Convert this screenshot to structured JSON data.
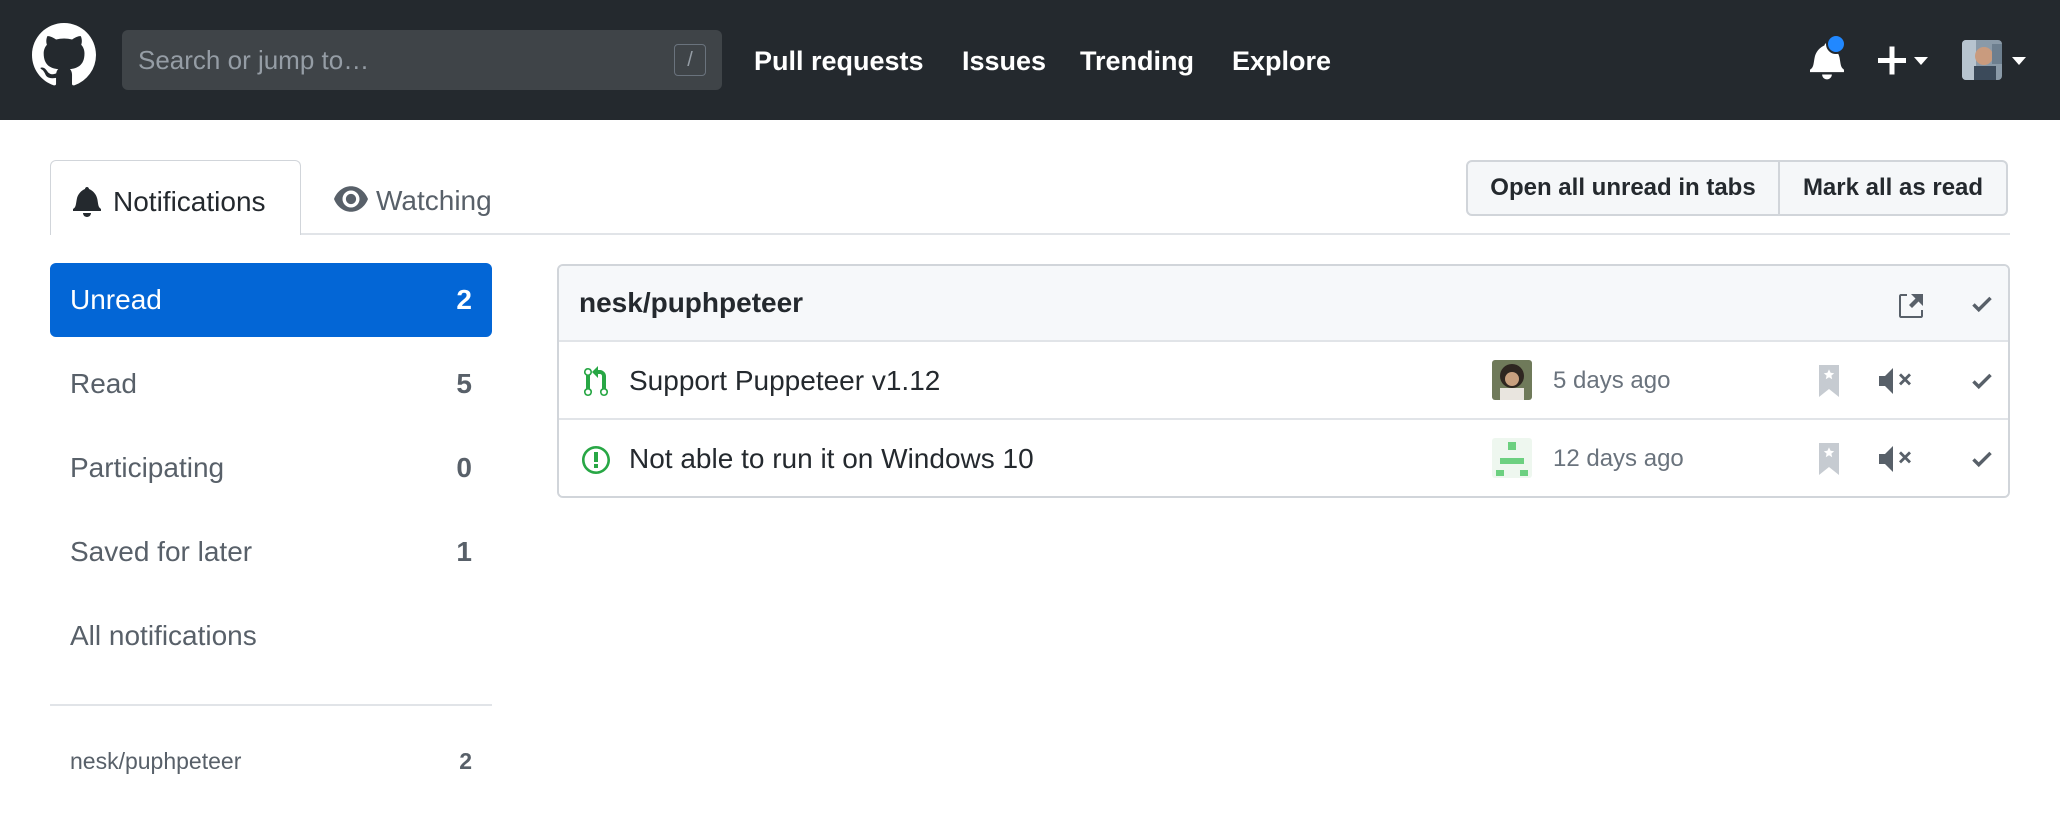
{
  "header": {
    "search": {
      "placeholder": "Search or jump to…",
      "shortcut": "/"
    },
    "nav": [
      {
        "label": "Pull requests"
      },
      {
        "label": "Issues"
      },
      {
        "label": "Trending"
      },
      {
        "label": "Explore"
      }
    ],
    "notification_indicator_color": "#2188ff",
    "background_color": "#24292e"
  },
  "tabs": [
    {
      "label": "Notifications",
      "icon": "bell-icon",
      "active": true
    },
    {
      "label": "Watching",
      "icon": "eye-icon",
      "active": false
    }
  ],
  "actions": {
    "open_all": "Open all unread in tabs",
    "mark_all": "Mark all as read"
  },
  "sidebar": {
    "items": [
      {
        "label": "Unread",
        "count": "2",
        "active": true
      },
      {
        "label": "Read",
        "count": "5"
      },
      {
        "label": "Participating",
        "count": "0"
      },
      {
        "label": "Saved for later",
        "count": "1"
      },
      {
        "label": "All notifications",
        "count": ""
      }
    ],
    "repos": [
      {
        "label": "nesk/puphpeteer",
        "count": "2"
      }
    ],
    "accent_color": "#0366d6"
  },
  "notifications": {
    "repo": "nesk/puphpeteer",
    "items": [
      {
        "type": "pull-request",
        "title": "Support Puppeteer v1.12",
        "time": "5 days ago"
      },
      {
        "type": "issue",
        "title": "Not able to run it on Windows 10",
        "time": "12 days ago"
      }
    ],
    "status_color": "#28a745"
  }
}
